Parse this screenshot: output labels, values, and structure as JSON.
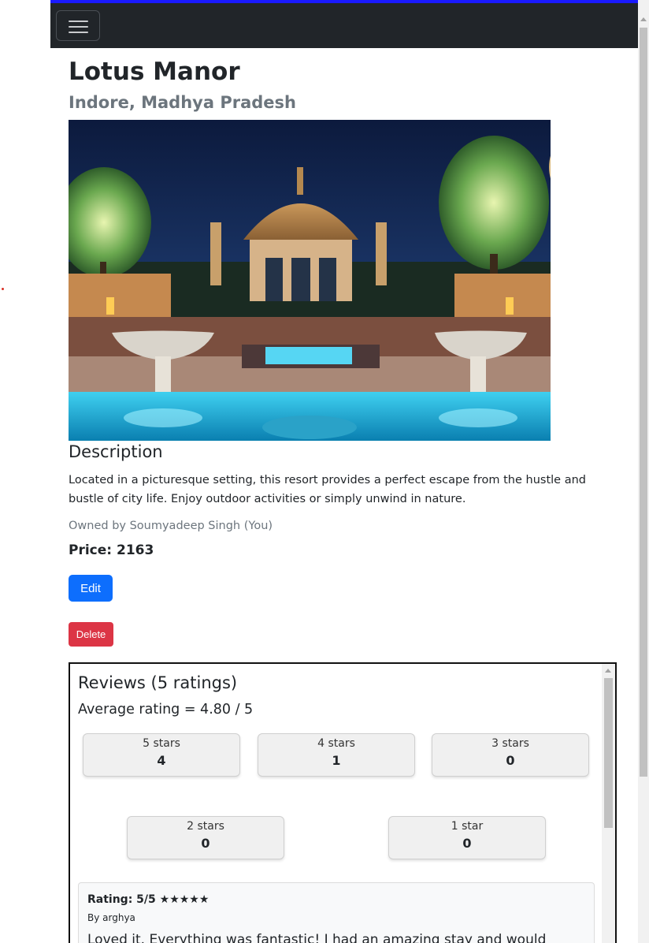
{
  "listing": {
    "title": "Lotus Manor",
    "location": "Indore, Madhya Pradesh",
    "description_heading": "Description",
    "description": "Located in a picturesque setting, this resort provides a perfect escape from the hustle and bustle of city life. Enjoy outdoor activities or simply unwind in nature.",
    "owner": "Owned by Soumyadeep Singh (You)",
    "price_label": "Price:",
    "price": "2163"
  },
  "actions": {
    "edit_label": "Edit",
    "delete_label": "Delete"
  },
  "reviews": {
    "title": "Reviews (5 ratings)",
    "average": "Average rating = 4.80 / 5",
    "breakdown": [
      {
        "label": "5 stars",
        "count": "4"
      },
      {
        "label": "4 stars",
        "count": "1"
      },
      {
        "label": "3 stars",
        "count": "0"
      },
      {
        "label": "2 stars",
        "count": "0"
      },
      {
        "label": "1 star",
        "count": "0"
      }
    ],
    "items": [
      {
        "rating": "Rating: 5/5 ★★★★★",
        "author": "By arghya",
        "text": "Loved it. Everything was fantastic! I had an amazing stay and would"
      }
    ]
  },
  "colors": {
    "navbar": "#212529",
    "accent_top": "#1a1aff",
    "edit": "#0d6efd",
    "delete": "#dc3545"
  },
  "icons": {
    "navbar_toggler": "hamburger-icon"
  }
}
